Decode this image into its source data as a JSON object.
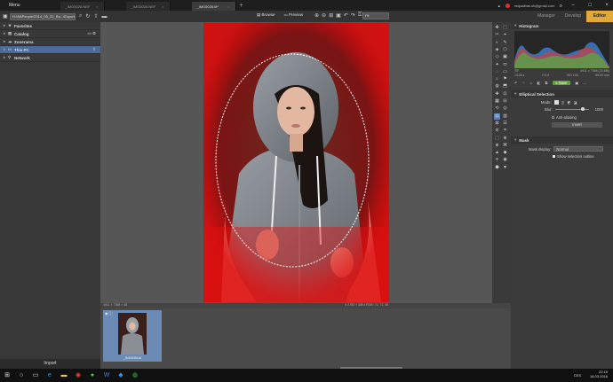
{
  "titlebar": {
    "menu_label": "Menu",
    "tabs": [
      {
        "label": "_IMG5026.NEF",
        "close": "×"
      },
      {
        "label": "_IMG5026.NEF",
        "close": "×"
      },
      {
        "label": "_IMG5026.tif*",
        "close": "×"
      }
    ],
    "new_tab": "+",
    "email": "mojaalbas.sk@gmail.com",
    "win_min": "–",
    "win_max": "□",
    "win_close": "×"
  },
  "topbar": {
    "path": "H:\\All\\People\\2014_05_22_Ra...\\Export",
    "browse_label": "Browse",
    "preview_label": "Preview",
    "zoom_value": "Fit",
    "modes": [
      "Manager",
      "Develop",
      "Editor"
    ]
  },
  "nav": {
    "items": [
      {
        "label": "Favorites",
        "icon": "star-icon"
      },
      {
        "label": "Catalog",
        "icon": "catalog-icon"
      },
      {
        "label": "Zonerama",
        "icon": "cloud-icon"
      },
      {
        "label": "This PC",
        "icon": "computer-icon"
      },
      {
        "label": "Network",
        "icon": "network-icon"
      }
    ],
    "import_label": "Import"
  },
  "canvas": {
    "image_info": "4911 × 7368 × 48",
    "coords": "X 2782  Y 3854   RGB: 71, 71, 35"
  },
  "histogram": {
    "title": "Histogram",
    "file_type": "TIF",
    "dimensions": "4911 × 7368 (23 MB)",
    "aperture": "F/2.8",
    "shutter": "1/125 s",
    "iso": "ISO 100",
    "focal": "85.00 mm",
    "save_label": "Save"
  },
  "selection": {
    "title": "Elliptical Selection",
    "mode_label": "Mode:",
    "blur_label": "Blur:",
    "blur_value": "1000",
    "blur_fraction": 0.85,
    "antialias_label": "Anti-aliasing",
    "invert_label": "Invert"
  },
  "mask": {
    "title": "Mask",
    "display_label": "Mask display:",
    "display_value": "Normal",
    "outline_label": "Show selection outline"
  },
  "filmstrip": {
    "thumb_name": "_IMG5026.tif"
  },
  "taskbar": {
    "time": "22:19",
    "date": "18.03.2016",
    "lang": "CES"
  },
  "colors": {
    "accent": "#e1a83a",
    "save_green": "#5aa532",
    "selected_nav": "#4a6a9a"
  }
}
